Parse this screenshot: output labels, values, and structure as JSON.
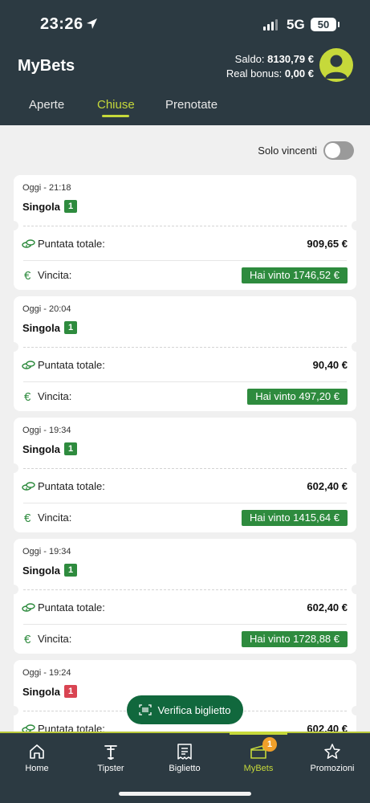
{
  "status_bar": {
    "time": "23:26",
    "network": "5G",
    "battery": "50"
  },
  "header": {
    "title": "MyBets",
    "saldo_label": "Saldo:",
    "saldo_value": "8130,79 €",
    "bonus_label": "Real bonus:",
    "bonus_value": "0,00 €"
  },
  "tabs": [
    {
      "label": "Aperte",
      "active": false
    },
    {
      "label": "Chiuse",
      "active": true
    },
    {
      "label": "Prenotate",
      "active": false
    }
  ],
  "filter": {
    "label": "Solo vincenti",
    "on": false
  },
  "bets": [
    {
      "date": "Oggi - 21:18",
      "type": "Singola",
      "badge": "1",
      "badge_color": "#2e8b3e",
      "stake_label": "Puntata totale:",
      "stake": "909,65 €",
      "win_label": "Vincita:",
      "win": "Hai vinto 1746,52 €"
    },
    {
      "date": "Oggi - 20:04",
      "type": "Singola",
      "badge": "1",
      "badge_color": "#2e8b3e",
      "stake_label": "Puntata totale:",
      "stake": "90,40 €",
      "win_label": "Vincita:",
      "win": "Hai vinto 497,20 €"
    },
    {
      "date": "Oggi - 19:34",
      "type": "Singola",
      "badge": "1",
      "badge_color": "#2e8b3e",
      "stake_label": "Puntata totale:",
      "stake": "602,40 €",
      "win_label": "Vincita:",
      "win": "Hai vinto 1415,64 €"
    },
    {
      "date": "Oggi - 19:34",
      "type": "Singola",
      "badge": "1",
      "badge_color": "#2e8b3e",
      "stake_label": "Puntata totale:",
      "stake": "602,40 €",
      "win_label": "Vincita:",
      "win": "Hai vinto 1728,88 €"
    },
    {
      "date": "Oggi - 19:24",
      "type": "Singola",
      "badge": "1",
      "badge_color": "#d94452",
      "stake_label": "Puntata totale:",
      "stake": "602,40 €",
      "win_label": "",
      "win": ""
    }
  ],
  "verify_button": {
    "label": "Verifica biglietto"
  },
  "nav": {
    "home": "Home",
    "tipster": "Tipster",
    "biglietto": "Biglietto",
    "mybets": "MyBets",
    "mybets_badge": "1",
    "promozioni": "Promozioni"
  },
  "colors": {
    "dark": "#2c3a42",
    "accent": "#c6d93a",
    "win_green": "#2e8b3e",
    "loss_red": "#d94452"
  }
}
